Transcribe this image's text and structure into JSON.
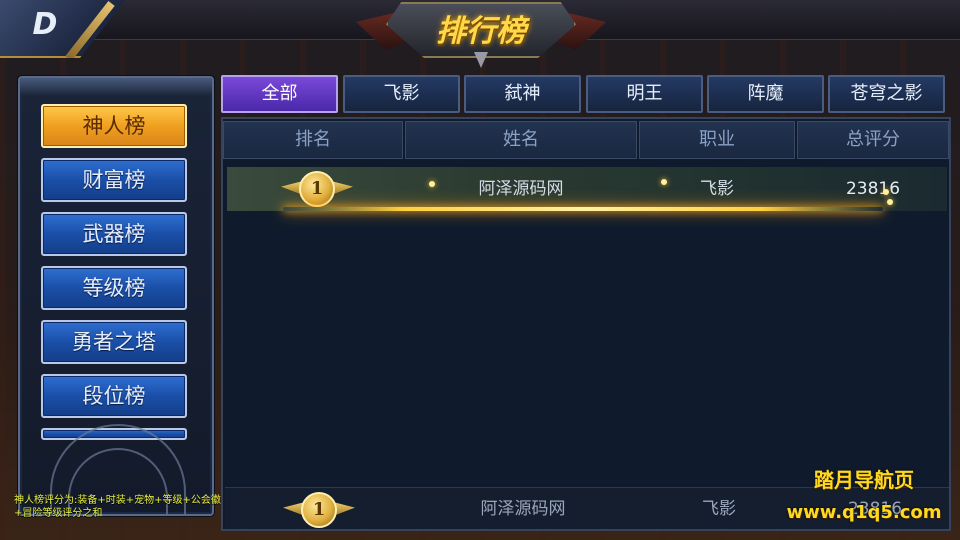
{
  "header": {
    "back_icon": "back-arrow-icon",
    "title": "排行榜"
  },
  "sidebar": {
    "items": [
      {
        "label": "神人榜",
        "active": true
      },
      {
        "label": "财富榜",
        "active": false
      },
      {
        "label": "武器榜",
        "active": false
      },
      {
        "label": "等级榜",
        "active": false
      },
      {
        "label": "勇者之塔",
        "active": false
      },
      {
        "label": "段位榜",
        "active": false
      }
    ],
    "note": "神人榜评分为:装备+时装+宠物+等级+公会徽记+冒险等级评分之和"
  },
  "tabs": [
    {
      "label": "全部",
      "active": true
    },
    {
      "label": "飞影",
      "active": false
    },
    {
      "label": "弑神",
      "active": false
    },
    {
      "label": "明王",
      "active": false
    },
    {
      "label": "阵魔",
      "active": false
    },
    {
      "label": "苍穹之影",
      "active": false
    }
  ],
  "table": {
    "columns": [
      "排名",
      "姓名",
      "职业",
      "总评分"
    ],
    "rows": [
      {
        "rank": "1",
        "name": "阿泽源码网",
        "class": "飞影",
        "score": "23816"
      }
    ],
    "self_row": {
      "rank": "1",
      "name": "阿泽源码网",
      "class": "飞影",
      "score": "23816"
    }
  },
  "watermark": {
    "line1": "踏月导航页",
    "line2": "www.q1q5.com"
  },
  "colors": {
    "active_tab": "#6a3ed0",
    "active_side": "#f0a020",
    "side_button": "#1a4fa8",
    "gold": "#ffd94a"
  }
}
